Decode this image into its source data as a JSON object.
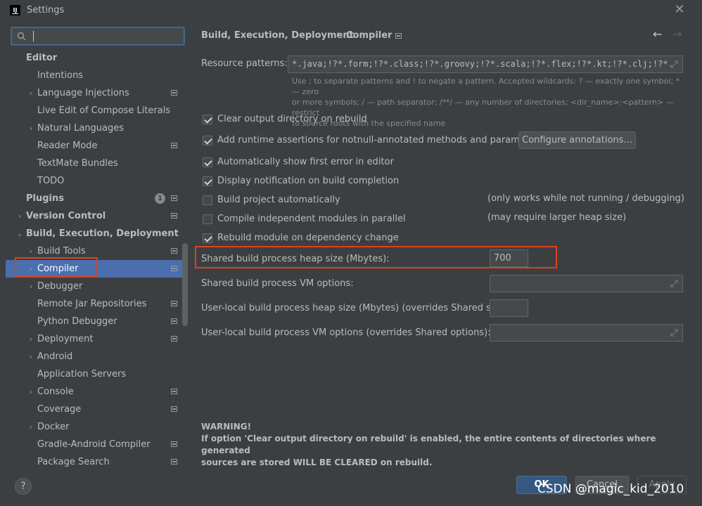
{
  "window": {
    "title": "Settings",
    "logo_text": "IJ"
  },
  "search": {
    "value": ""
  },
  "sidebar": {
    "items": [
      {
        "label": "Editor",
        "bold": true,
        "arrow": ""
      },
      {
        "label": "Intentions",
        "arrow": ""
      },
      {
        "label": "Language Injections",
        "arrow": "›",
        "proj": true
      },
      {
        "label": "Live Edit of Compose Literals",
        "arrow": ""
      },
      {
        "label": "Natural Languages",
        "arrow": "›"
      },
      {
        "label": "Reader Mode",
        "arrow": "",
        "proj": true
      },
      {
        "label": "TextMate Bundles",
        "arrow": ""
      },
      {
        "label": "TODO",
        "arrow": ""
      },
      {
        "label": "Plugins",
        "bold": true,
        "arrow": "",
        "badge": "1",
        "proj": true
      },
      {
        "label": "Version Control",
        "bold": true,
        "arrow": "›",
        "proj": true
      },
      {
        "label": "Build, Execution, Deployment",
        "bold": true,
        "arrow": "⌄"
      },
      {
        "label": "Build Tools",
        "arrow": "›",
        "proj": true
      },
      {
        "label": "Compiler",
        "arrow": "›",
        "proj": true,
        "selected": true
      },
      {
        "label": "Debugger",
        "arrow": "›"
      },
      {
        "label": "Remote Jar Repositories",
        "arrow": "",
        "proj": true
      },
      {
        "label": "Python Debugger",
        "arrow": "",
        "proj": true
      },
      {
        "label": "Deployment",
        "arrow": "›",
        "proj": true
      },
      {
        "label": "Android",
        "arrow": "›"
      },
      {
        "label": "Application Servers",
        "arrow": ""
      },
      {
        "label": "Console",
        "arrow": "›",
        "proj": true
      },
      {
        "label": "Coverage",
        "arrow": "",
        "proj": true
      },
      {
        "label": "Docker",
        "arrow": "›"
      },
      {
        "label": "Gradle-Android Compiler",
        "arrow": "",
        "proj": true
      },
      {
        "label": "Package Search",
        "arrow": "",
        "proj": true
      }
    ]
  },
  "main": {
    "breadcrumb": {
      "parent": "Build, Execution, Deployment",
      "separator": "›",
      "current": "Compiler"
    },
    "nav": {
      "back": "←",
      "forward": "→"
    },
    "resource_patterns": {
      "label": "Resource patterns:",
      "value": "*.java;!?*.form;!?*.class;!?*.groovy;!?*.scala;!?*.flex;!?*.kt;!?*.clj;!?*.a",
      "hint_line1": "Use ; to separate patterns and ! to negate a pattern. Accepted wildcards: ? — exactly one symbol; * — zero",
      "hint_line2": "or more symbols; / — path separator; /**/ — any number of directories; <dir_name>:<pattern> — restrict",
      "hint_line3": "to source roots with the specified name"
    },
    "checkboxes": [
      {
        "label": "Clear output directory on rebuild",
        "checked": true,
        "note": ""
      },
      {
        "label": "Add runtime assertions for notnull-annotated methods and parameters",
        "checked": true,
        "note": ""
      },
      {
        "label": "Automatically show first error in editor",
        "checked": true,
        "note": ""
      },
      {
        "label": "Display notification on build completion",
        "checked": true,
        "note": ""
      },
      {
        "label": "Build project automatically",
        "checked": false,
        "note": "(only works while not running / debugging)"
      },
      {
        "label": "Compile independent modules in parallel",
        "checked": false,
        "note": "(may require larger heap size)"
      },
      {
        "label": "Rebuild module on dependency change",
        "checked": true,
        "note": ""
      }
    ],
    "configure_button": "Configure annotations...",
    "heap": {
      "label": "Shared build process heap size (Mbytes):",
      "value": "700"
    },
    "vm_options": {
      "label": "Shared build process VM options:",
      "value": ""
    },
    "user_heap": {
      "label": "User-local build process heap size (Mbytes) (overrides Shared size):",
      "value": ""
    },
    "user_vm": {
      "label": "User-local build process VM options (overrides Shared options):",
      "value": ""
    },
    "warning": {
      "title": "WARNING!",
      "line1": "If option 'Clear output directory on rebuild' is enabled, the entire contents of directories where generated",
      "line2": "sources are stored WILL BE CLEARED on rebuild."
    }
  },
  "footer": {
    "help": "?",
    "ok": "OK",
    "cancel": "Cancel",
    "apply": "Apply",
    "watermark": "CSDN @magic_kid_2010"
  },
  "colors": {
    "accent": "#4b6eaf",
    "highlight_box": "#e0401c",
    "background": "#3c3f41"
  }
}
